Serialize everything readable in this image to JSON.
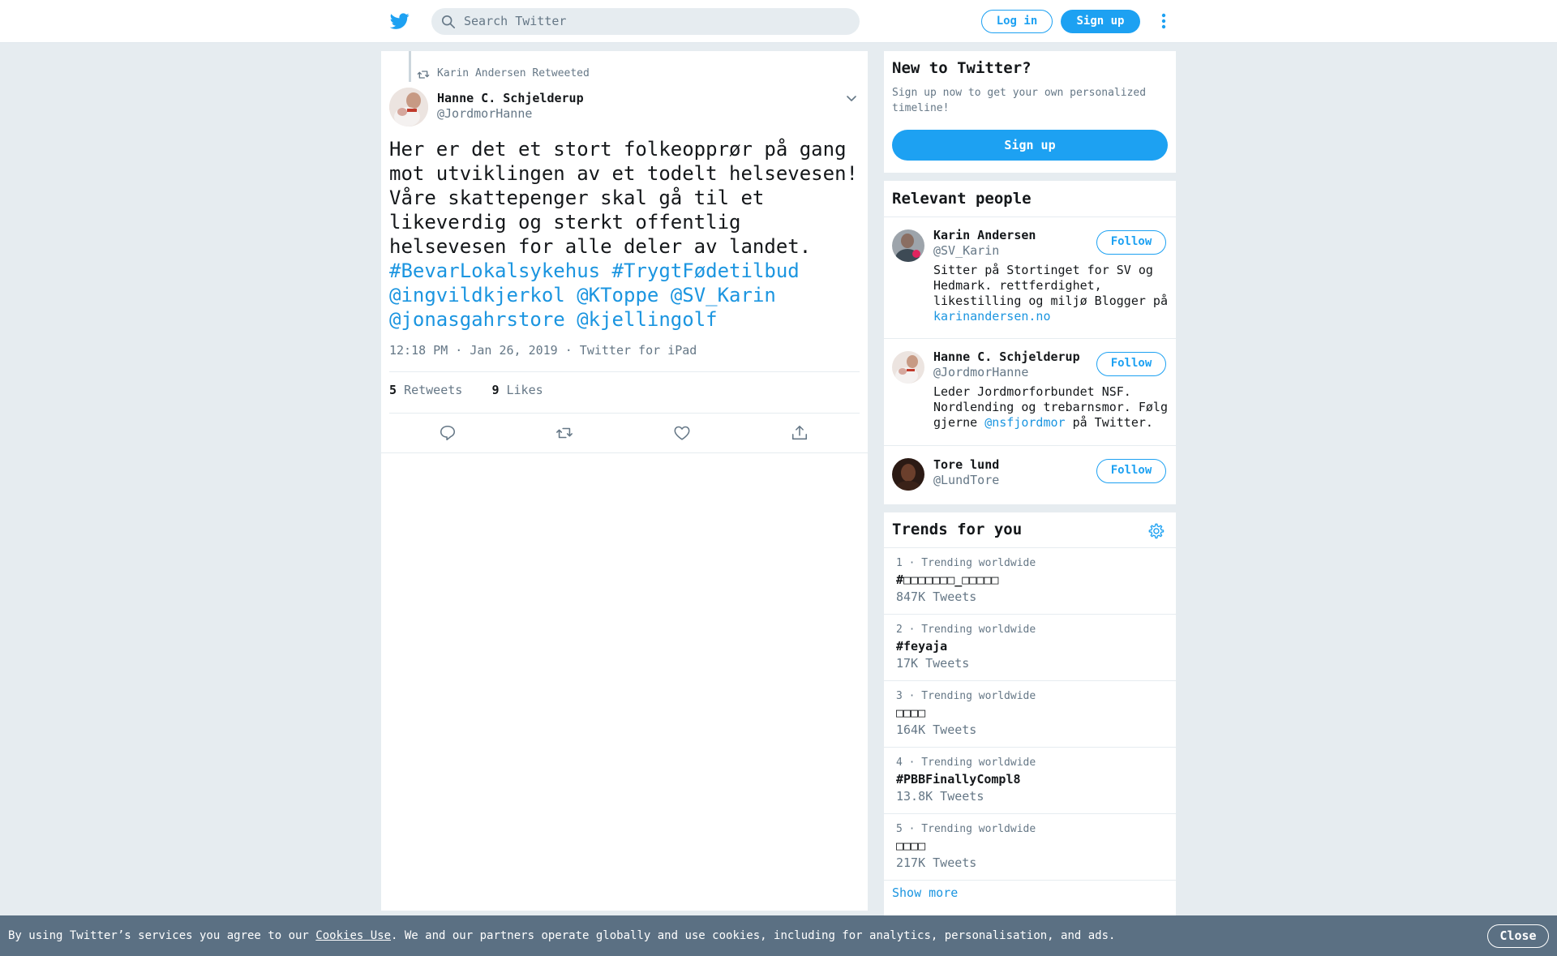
{
  "header": {
    "search_placeholder": "Search Twitter",
    "login_label": "Log in",
    "signup_label": "Sign up"
  },
  "tweet": {
    "retweeted_by": "Karin Andersen Retweeted",
    "author_name": "Hanne C. Schjelderup",
    "author_handle": "@JordmorHanne",
    "body": "Her er det et stort folkeopprør på gang mot utviklingen av et todelt helsevesen! Våre skattepenger skal gå til et likeverdig og sterkt offentlig helsevesen for alle deler av landet. ",
    "links": [
      "#BevarLokalsykehus",
      "#TrygtFødetilbud",
      "@ingvildkjerkol",
      "@KToppe",
      "@SV_Karin",
      "@jonasgahrstore",
      "@kjellingolf"
    ],
    "meta": "12:18 PM · Jan 26, 2019 · Twitter for iPad",
    "retweets_count": "5",
    "retweets_label": "Retweets",
    "likes_count": "9",
    "likes_label": "Likes"
  },
  "new_to_twitter": {
    "title": "New to Twitter?",
    "description": "Sign up now to get your own personalized timeline!",
    "signup_label": "Sign up"
  },
  "relevant_people": {
    "title": "Relevant people",
    "follow_label": "Follow",
    "people": [
      {
        "name": "Karin Andersen",
        "handle": "@SV_Karin",
        "bio": "Sitter på Stortinget for SV og Hedmark. rettferdighet, likestilling og miljø Blogger på ",
        "bio_link": "karinandersen.no",
        "bio_after": ""
      },
      {
        "name": "Hanne C. Schjelderup",
        "handle": "@JordmorHanne",
        "bio": "Leder Jordmorforbundet NSF. Nordlending og trebarnsmor. Følg gjerne ",
        "bio_link": "@nsfjordmor",
        "bio_after": " på Twitter."
      },
      {
        "name": "Tore lund",
        "handle": "@LundTore",
        "bio": "",
        "bio_link": "",
        "bio_after": ""
      }
    ]
  },
  "trends": {
    "title": "Trends for you",
    "items": [
      {
        "meta": "1 · Trending worldwide",
        "name": "#□□□□□□□_□□□□□",
        "count": "847K Tweets"
      },
      {
        "meta": "2 · Trending worldwide",
        "name": "#feyaja",
        "count": "17K Tweets"
      },
      {
        "meta": "3 · Trending worldwide",
        "name": "□□□□",
        "count": "164K Tweets"
      },
      {
        "meta": "4 · Trending worldwide",
        "name": "#PBBFinallyCompl8",
        "count": "13.8K Tweets"
      },
      {
        "meta": "5 · Trending worldwide",
        "name": "□□□□",
        "count": "217K Tweets"
      }
    ],
    "show_more": "Show more"
  },
  "cookie": {
    "prefix": "By using Twitter’s services you agree to our ",
    "link": "Cookies Use",
    "suffix": ". We and our partners operate globally and use cookies, including for analytics, personalisation, and ads.",
    "close_label": "Close"
  },
  "colors": {
    "brand": "#1da1f2",
    "link": "#1b95e0",
    "background": "#e6ecf0",
    "cookie_bar": "#5b7083"
  },
  "icons": [
    "twitter-bird-icon",
    "search-icon",
    "more-vertical-icon",
    "retweet-icon",
    "chevron-down-icon",
    "reply-icon",
    "like-icon",
    "share-icon",
    "gear-icon"
  ]
}
